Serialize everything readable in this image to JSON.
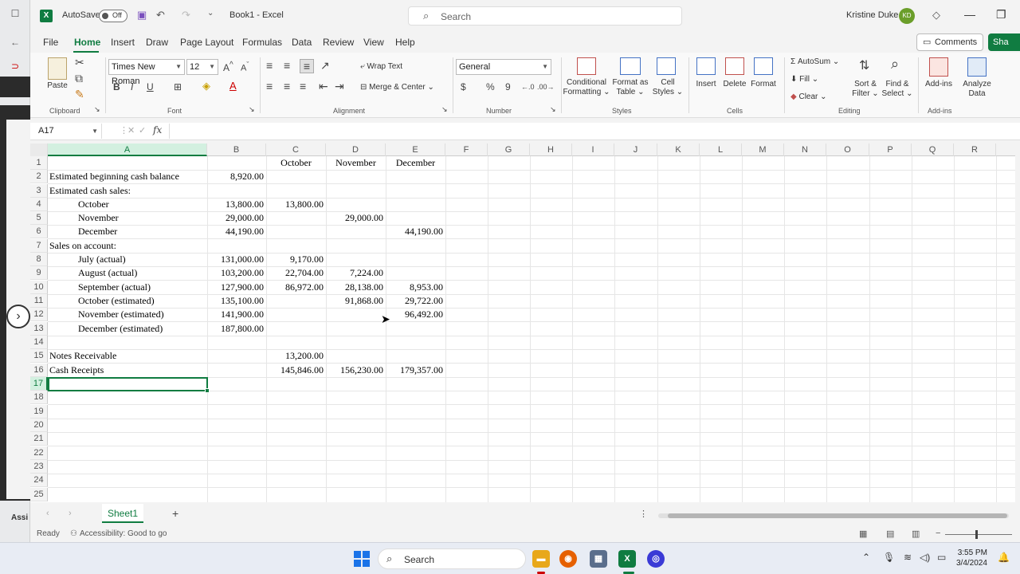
{
  "titlebar": {
    "autosave_label": "AutoSave",
    "autosave_state": "Off",
    "doc_title": "Book1  -  Excel",
    "search_placeholder": "Search",
    "user_name": "Kristine Duke",
    "user_initials": "KD"
  },
  "tabs": [
    "File",
    "Home",
    "Insert",
    "Draw",
    "Page Layout",
    "Formulas",
    "Data",
    "Review",
    "View",
    "Help"
  ],
  "active_tab": "Home",
  "comments_label": "Comments",
  "share_label": "Sha",
  "ribbon": {
    "paste": "Paste",
    "clipboard": "Clipboard",
    "font_name": "Times New Roman",
    "font_size": "12",
    "font": "Font",
    "wrap_text": "Wrap Text",
    "merge_center": "Merge & Center",
    "alignment": "Alignment",
    "number_format": "General",
    "number": "Number",
    "conditional": "Conditional",
    "formatting": "Formatting",
    "format_as": "Format as",
    "table": "Table",
    "cell": "Cell",
    "styles_btn": "Styles",
    "styles": "Styles",
    "insert": "Insert",
    "delete": "Delete",
    "format": "Format",
    "cells": "Cells",
    "autosum": "AutoSum",
    "fill": "Fill",
    "clear": "Clear",
    "sort_filter_1": "Sort &",
    "sort_filter_2": "Filter",
    "find_select_1": "Find &",
    "find_select_2": "Select",
    "editing": "Editing",
    "addins_btn": "Add-ins",
    "addins": "Add-ins",
    "analyze_1": "Analyze",
    "analyze_2": "Data"
  },
  "formula_bar": {
    "name_box": "A17",
    "fx": "fx",
    "value": ""
  },
  "columns": [
    "A",
    "B",
    "C",
    "D",
    "E",
    "F",
    "G",
    "H",
    "I",
    "J",
    "K",
    "L",
    "M",
    "N",
    "O",
    "P",
    "Q",
    "R"
  ],
  "rows": [
    "1",
    "2",
    "3",
    "4",
    "5",
    "6",
    "7",
    "8",
    "9",
    "10",
    "11",
    "12",
    "13",
    "14",
    "15",
    "16",
    "17",
    "18",
    "19",
    "20",
    "21",
    "22",
    "23",
    "24",
    "25"
  ],
  "cells": {
    "C1": "October",
    "D1": "November",
    "E1": "December",
    "A2": "Estimated beginning cash balance",
    "B2": "8,920.00",
    "A3": "Estimated cash sales:",
    "A4": "October",
    "B4": "13,800.00",
    "C4": "13,800.00",
    "A5": "November",
    "B5": "29,000.00",
    "D5": "29,000.00",
    "A6": "December",
    "B6": "44,190.00",
    "E6": "44,190.00",
    "A7": "Sales on account:",
    "A8": "July (actual)",
    "B8": "131,000.00",
    "C8": "9,170.00",
    "A9": "August (actual)",
    "B9": "103,200.00",
    "C9": "22,704.00",
    "D9": "7,224.00",
    "A10": "September (actual)",
    "B10": "127,900.00",
    "C10": "86,972.00",
    "D10": "28,138.00",
    "E10": "8,953.00",
    "A11": "October (estimated)",
    "B11": "135,100.00",
    "D11": "91,868.00",
    "E11": "29,722.00",
    "A12": "November (estimated)",
    "B12": "141,900.00",
    "E12": "96,492.00",
    "A13": "December (estimated)",
    "B13": "187,800.00",
    "A15": "Notes Receivable",
    "C15": "13,200.00",
    "A16": "Cash Receipts",
    "C16": "145,846.00",
    "D16": "156,230.00",
    "E16": "179,357.00"
  },
  "sheet_tab": "Sheet1",
  "status": {
    "ready": "Ready",
    "accessibility": "Accessibility: Good to go"
  },
  "taskbar": {
    "search": "Search",
    "time": "3:55 PM",
    "date": "3/4/2024"
  },
  "colors": {
    "excel_green": "#107c41",
    "accent_purple": "#7a4fbd"
  }
}
